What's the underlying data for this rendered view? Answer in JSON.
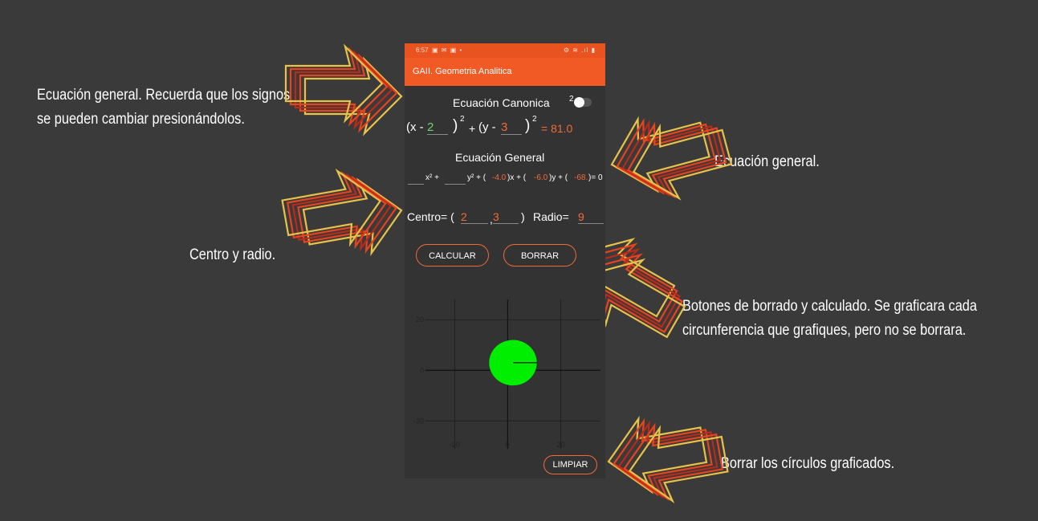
{
  "status_bar": {
    "time": "6:57",
    "left_icons": "▣ ✉ ▣ •",
    "right_icons": "⚙ ≋ .ıl ▮"
  },
  "app": {
    "title": "GAII. Geometria Analitica"
  },
  "canonical": {
    "heading": "Ecuación Canonica",
    "toggle_hint": "2",
    "x_prefix": "(x -",
    "h": "2",
    "y_prefix": "(y -",
    "k": "3",
    "close_paren": ")",
    "exponent": "2",
    "plus": "+",
    "equals_value": "= 81.0"
  },
  "general": {
    "heading": "Ecuación General",
    "x2_term": "x² +",
    "y2_term": "y² + (",
    "d": "-4.0",
    "x_term": ")x + (",
    "e": "-6.0",
    "y_term": ")y + (",
    "f": "-68.",
    "end": ")=  0"
  },
  "centro": {
    "label": "Centro= (",
    "x": "2",
    "comma": ",",
    "y": "3",
    "close": ")"
  },
  "radio": {
    "label": "Radio=",
    "value": "9"
  },
  "buttons": {
    "calcular": "CALCULAR",
    "borrar": "BORRAR",
    "limpiar": "LIMPIAR"
  },
  "plot": {
    "x_ticks": [
      "-20",
      "0",
      "20"
    ],
    "y_ticks": [
      "20",
      "0",
      "-20"
    ],
    "circle": {
      "cx": 2,
      "cy": 3,
      "r": 9,
      "fill": "#00ee00"
    },
    "x_range": [
      -31,
      35
    ],
    "y_range": [
      -31,
      28
    ]
  },
  "annotations": {
    "a1_line1": "Ecuación general. Recuerda que los signos",
    "a1_line2": "se pueden cambiar presionándolos.",
    "a2": "Ecuación general.",
    "a3": "Centro y radio.",
    "a4_line1": "Botones de borrado y calculado. Se graficara cada",
    "a4_line2": "circunferencia que grafiques, pero no se borrara.",
    "a5": "Borrar los círculos graficados."
  },
  "colors": {
    "accent": "#f15a24",
    "arrow_outer": "#e8c24a",
    "arrow_mid": "#e8431f",
    "arrow_inner": "#b82a1a"
  }
}
